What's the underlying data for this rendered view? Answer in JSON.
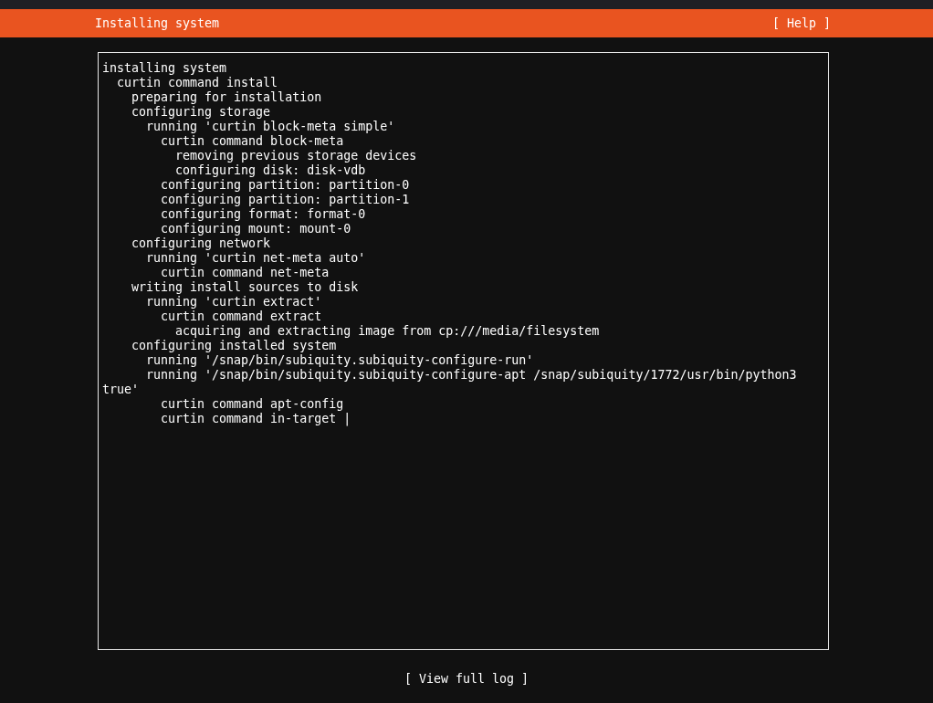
{
  "header": {
    "title": "Installing system",
    "help_button": "[ Help ]"
  },
  "log": [
    {
      "text": "installing system",
      "children": [
        {
          "text": "curtin command install",
          "children": [
            {
              "text": "preparing for installation"
            },
            {
              "text": "configuring storage",
              "children": [
                {
                  "text": "running 'curtin block-meta simple'",
                  "children": [
                    {
                      "text": "curtin command block-meta",
                      "children": [
                        {
                          "text": "removing previous storage devices"
                        },
                        {
                          "text": "configuring disk: disk-vdb"
                        }
                      ]
                    },
                    {
                      "text": "configuring partition: partition-0"
                    },
                    {
                      "text": "configuring partition: partition-1"
                    },
                    {
                      "text": "configuring format: format-0"
                    },
                    {
                      "text": "configuring mount: mount-0"
                    }
                  ]
                }
              ]
            },
            {
              "text": "configuring network",
              "children": [
                {
                  "text": "running 'curtin net-meta auto'",
                  "children": [
                    {
                      "text": "curtin command net-meta"
                    }
                  ]
                }
              ]
            },
            {
              "text": "writing install sources to disk",
              "children": [
                {
                  "text": "running 'curtin extract'",
                  "children": [
                    {
                      "text": "curtin command extract",
                      "children": [
                        {
                          "text": "acquiring and extracting image from cp:///media/filesystem"
                        }
                      ]
                    }
                  ]
                }
              ]
            },
            {
              "text": "configuring installed system",
              "children": [
                {
                  "text": "running '/snap/bin/subiquity.subiquity-configure-run'"
                },
                {
                  "text": "running '/snap/bin/subiquity.subiquity-configure-apt /snap/subiquity/1772/usr/bin/python3 true'",
                  "children": [
                    {
                      "text": "curtin command apt-config"
                    },
                    {
                      "text": "curtin command in-target |"
                    }
                  ]
                }
              ]
            }
          ]
        }
      ]
    }
  ],
  "footer_button": "[ View full log ]"
}
